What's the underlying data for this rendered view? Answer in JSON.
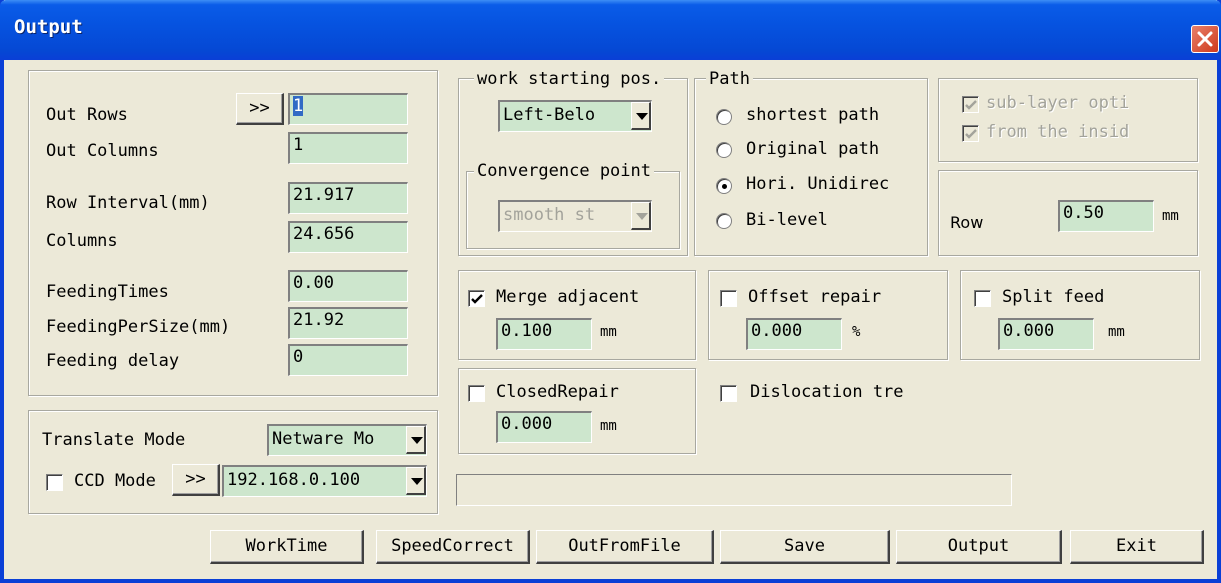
{
  "window": {
    "title": "Output"
  },
  "rows_panel": {
    "out_rows_label": "Out Rows",
    "out_rows_btn": ">>",
    "out_rows_value": "1",
    "out_columns_label": "Out Columns",
    "out_columns_value": "1",
    "row_interval_label": "Row Interval(mm)",
    "row_interval_value": "21.917",
    "columns_label": "Columns",
    "columns_value": "24.656",
    "feeding_times_label": "FeedingTimes",
    "feeding_times_value": "0.00",
    "feeding_per_size_label": "FeedingPerSize(mm)",
    "feeding_per_size_value": "21.92",
    "feeding_delay_label": "Feeding delay",
    "feeding_delay_value": "0"
  },
  "translate_panel": {
    "translate_mode_label": "Translate Mode",
    "translate_mode_value": "Netware Mo",
    "ccd_mode_label": "CCD Modе",
    "ccd_btn": ">>",
    "ip_value": "192.168.0.100"
  },
  "start_panel": {
    "legend": "work starting pos.",
    "start_pos_value": "Left-Belo",
    "convergence_legend": "Convergence point",
    "convergence_value": "smooth st"
  },
  "path_panel": {
    "legend": "Path",
    "options": [
      "shortest path",
      "Original path",
      "Hori. Unidirec",
      "Bi-level"
    ],
    "selected_index": 2
  },
  "sublayer_panel": {
    "sub_layer_label": "sub-layer opti",
    "from_inside_label": "from the insid"
  },
  "row_panel": {
    "row_label": "Row",
    "row_value": "0.50",
    "unit": "mm"
  },
  "merge_panel": {
    "label": "Merge adjacent",
    "checked": true,
    "value": "0.100",
    "unit": "mm"
  },
  "offset_panel": {
    "label": "Offset repair",
    "checked": false,
    "value": "0.000",
    "unit": "%"
  },
  "split_panel": {
    "label": "Split feed",
    "checked": false,
    "value": "0.000",
    "unit": "mm"
  },
  "closed_panel": {
    "label": "ClosedRepair",
    "checked": false,
    "value": "0.000",
    "unit": "mm"
  },
  "dislocation": {
    "label": "Dislocation tre",
    "checked": false
  },
  "buttons": {
    "worktime": "WorkTime",
    "speedcorrect": "SpeedCorrect",
    "outfromfile": "OutFromFile",
    "save": "Save",
    "output": "Output",
    "exit": "Exit"
  }
}
